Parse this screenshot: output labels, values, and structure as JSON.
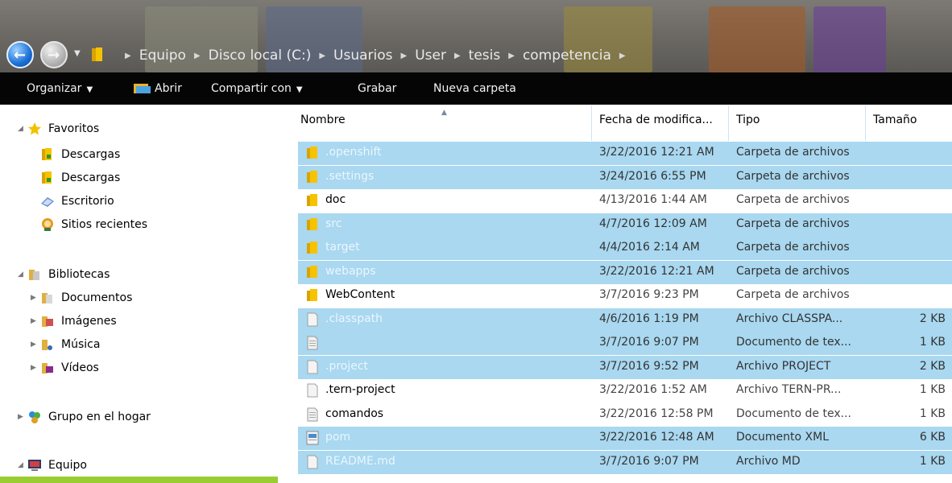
{
  "breadcrumb": [
    "Equipo",
    "Disco local (C:)",
    "Usuarios",
    "User",
    "tesis",
    "competencia"
  ],
  "toolbar": {
    "organize": "Organizar",
    "open": "Abrir",
    "share": "Compartir con",
    "burn": "Grabar",
    "new_folder": "Nueva carpeta"
  },
  "nav": {
    "favorites": "Favoritos",
    "fav_items": [
      "Descargas",
      "Descargas",
      "Escritorio",
      "Sitios recientes"
    ],
    "libraries": "Bibliotecas",
    "lib_items": [
      "Documentos",
      "Imágenes",
      "Música",
      "Vídeos"
    ],
    "homegroup": "Grupo en el hogar",
    "computer": "Equipo"
  },
  "columns": {
    "name": "Nombre",
    "date": "Fecha de modifica...",
    "type": "Tipo",
    "size": "Tamaño"
  },
  "files": [
    {
      "name": ".openshift",
      "date": "3/22/2016 12:21 AM",
      "type": "Carpeta de archivos",
      "size": "",
      "icon": "folder-icon",
      "selected": true
    },
    {
      "name": ".settings",
      "date": "3/24/2016 6:55 PM",
      "type": "Carpeta de archivos",
      "size": "",
      "icon": "folder-icon",
      "selected": true
    },
    {
      "name": "doc",
      "date": "4/13/2016 1:44 AM",
      "type": "Carpeta de archivos",
      "size": "",
      "icon": "folder-icon",
      "selected": false
    },
    {
      "name": "src",
      "date": "4/7/2016 12:09 AM",
      "type": "Carpeta de archivos",
      "size": "",
      "icon": "folder-icon",
      "selected": true
    },
    {
      "name": "target",
      "date": "4/4/2016 2:14 AM",
      "type": "Carpeta de archivos",
      "size": "",
      "icon": "folder-icon",
      "selected": true
    },
    {
      "name": "webapps",
      "date": "3/22/2016 12:21 AM",
      "type": "Carpeta de archivos",
      "size": "",
      "icon": "folder-icon",
      "selected": true
    },
    {
      "name": "WebContent",
      "date": "3/7/2016 9:23 PM",
      "type": "Carpeta de archivos",
      "size": "",
      "icon": "folder-icon",
      "selected": false
    },
    {
      "name": ".classpath",
      "date": "4/6/2016 1:19 PM",
      "type": "Archivo CLASSPA...",
      "size": "2 KB",
      "icon": "file-icon",
      "selected": true
    },
    {
      "name": "",
      "date": "3/7/2016 9:07 PM",
      "type": "Documento de tex...",
      "size": "1 KB",
      "icon": "text-file-icon",
      "selected": true
    },
    {
      "name": ".project",
      "date": "3/7/2016 9:52 PM",
      "type": "Archivo PROJECT",
      "size": "2 KB",
      "icon": "file-icon",
      "selected": true
    },
    {
      "name": ".tern-project",
      "date": "3/22/2016 1:52 AM",
      "type": "Archivo TERN-PR...",
      "size": "1 KB",
      "icon": "file-icon",
      "selected": false
    },
    {
      "name": "comandos",
      "date": "3/22/2016 12:58 PM",
      "type": "Documento de tex...",
      "size": "1 KB",
      "icon": "text-file-icon",
      "selected": false
    },
    {
      "name": "pom",
      "date": "3/22/2016 12:48 AM",
      "type": "Documento XML",
      "size": "6 KB",
      "icon": "xml-file-icon",
      "selected": true
    },
    {
      "name": "README.md",
      "date": "3/7/2016 9:07 PM",
      "type": "Archivo MD",
      "size": "1 KB",
      "icon": "file-icon",
      "selected": true
    }
  ],
  "colors": {
    "selection": "#a9d8f0",
    "toolbar_bg": "#050505",
    "nav_selection": "#9acd32"
  }
}
